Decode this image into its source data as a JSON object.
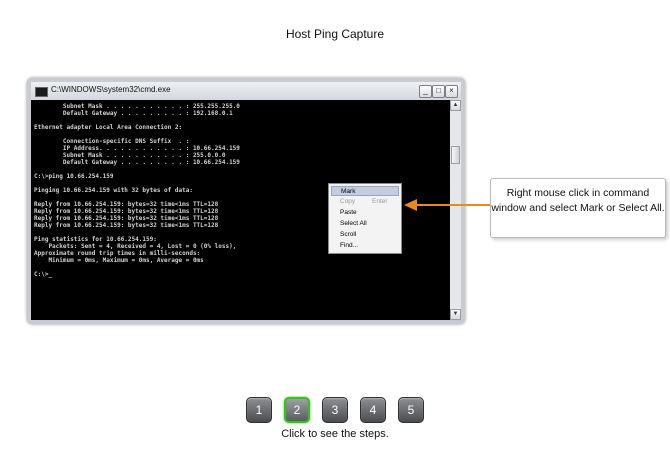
{
  "page": {
    "title": "Host Ping Capture"
  },
  "window": {
    "title": "C:\\WINDOWS\\system32\\cmd.exe",
    "buttons": {
      "minimize": "_",
      "maximize": "□",
      "close": "×"
    }
  },
  "console_lines": [
    "        Subnet Mask . . . . . . . . . . . : 255.255.255.0",
    "        Default Gateway . . . . . . . . . : 192.168.0.1",
    "",
    "Ethernet adapter Local Area Connection 2:",
    "",
    "        Connection-specific DNS Suffix  . :",
    "        IP Address. . . . . . . . . . . . : 10.66.254.159",
    "        Subnet Mask . . . . . . . . . . . : 255.0.0.0",
    "        Default Gateway . . . . . . . . . : 10.66.254.159",
    "",
    "C:\\>ping 10.66.254.159",
    "",
    "Pinging 10.66.254.159 with 32 bytes of data:",
    "",
    "Reply from 10.66.254.159: bytes=32 time<1ms TTL=128",
    "Reply from 10.66.254.159: bytes=32 time<1ms TTL=128",
    "Reply from 10.66.254.159: bytes=32 time<1ms TTL=128",
    "Reply from 10.66.254.159: bytes=32 time<1ms TTL=128",
    "",
    "Ping statistics for 10.66.254.159:",
    "    Packets: Sent = 4, Received = 4, Lost = 0 (0% loss),",
    "Approximate round trip times in milli-seconds:",
    "    Minimum = 0ms, Maximum = 0ms, Average = 0ms",
    "",
    "C:\\>_"
  ],
  "context_menu": {
    "items": [
      {
        "label": "Mark",
        "accel": "",
        "highlighted": true,
        "disabled": false
      },
      {
        "label": "Copy",
        "accel": "Enter",
        "highlighted": false,
        "disabled": true
      },
      {
        "label": "Paste",
        "accel": "",
        "highlighted": false,
        "disabled": false
      },
      {
        "label": "Select All",
        "accel": "",
        "highlighted": false,
        "disabled": false
      },
      {
        "label": "Scroll",
        "accel": "",
        "highlighted": false,
        "disabled": false
      },
      {
        "label": "Find...",
        "accel": "",
        "highlighted": false,
        "disabled": false
      }
    ]
  },
  "callout": {
    "text": "Right mouse click in command window and select Mark or Select All.",
    "arrow_color": "#e88a1c"
  },
  "steps": {
    "labels": [
      "1",
      "2",
      "3",
      "4",
      "5"
    ],
    "active": "2",
    "active_color": "#35c21f",
    "hint": "Click to see the steps."
  }
}
